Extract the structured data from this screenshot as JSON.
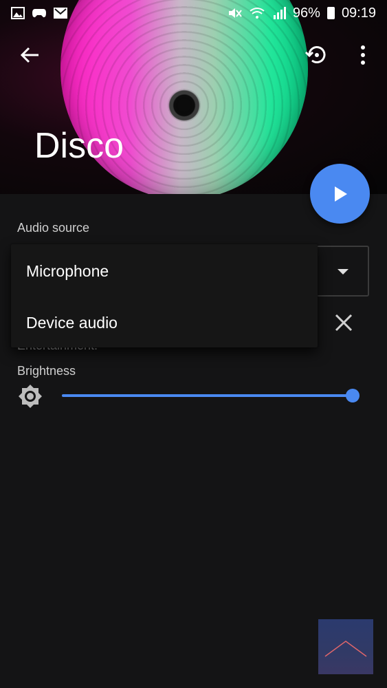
{
  "status_bar": {
    "battery": "96%",
    "time": "09:19",
    "icons": [
      "image-icon",
      "gamepad-icon",
      "gmail-icon",
      "mute-icon",
      "wifi-icon",
      "signal-icon",
      "battery-icon"
    ]
  },
  "header": {
    "title": "Disco",
    "icons": [
      "back-arrow-icon",
      "history-icon",
      "more-vert-icon"
    ]
  },
  "fab": {
    "icon": "play-icon",
    "color": "#4a89f1"
  },
  "audio_source": {
    "label": "Audio source",
    "options": [
      "Microphone",
      "Device audio"
    ]
  },
  "partially_hidden_label": "Entertainment:",
  "brightness": {
    "label": "Brightness",
    "icon": "brightness-icon",
    "value": 1.0
  },
  "colors": {
    "accent": "#4a89f1",
    "background": "#141415",
    "menu": "#161616"
  }
}
